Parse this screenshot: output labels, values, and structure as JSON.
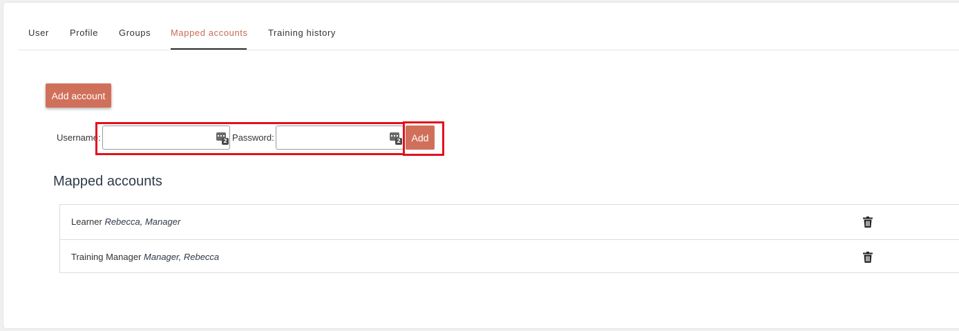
{
  "tabs": [
    {
      "label": "User",
      "active": false
    },
    {
      "label": "Profile",
      "active": false
    },
    {
      "label": "Groups",
      "active": false
    },
    {
      "label": "Mapped accounts",
      "active": true
    },
    {
      "label": "Training history",
      "active": false
    }
  ],
  "add_account_label": "Add account",
  "form": {
    "username_label": "Username:",
    "username_value": "",
    "password_label": "Password:",
    "password_value": "",
    "add_label": "Add",
    "field_icon": "password-manager-icon",
    "field_icon_badge": "2"
  },
  "section_title": "Mapped accounts",
  "accounts": [
    {
      "role": "Learner",
      "name": "Rebecca, Manager",
      "action_icon": "trash-icon"
    },
    {
      "role": "Training Manager",
      "name": "Manager, Rebecca",
      "action_icon": "trash-icon"
    }
  ],
  "colors": {
    "accent": "#d0705a",
    "active_tab_text": "#c76b55",
    "highlight": "#e3101c"
  }
}
